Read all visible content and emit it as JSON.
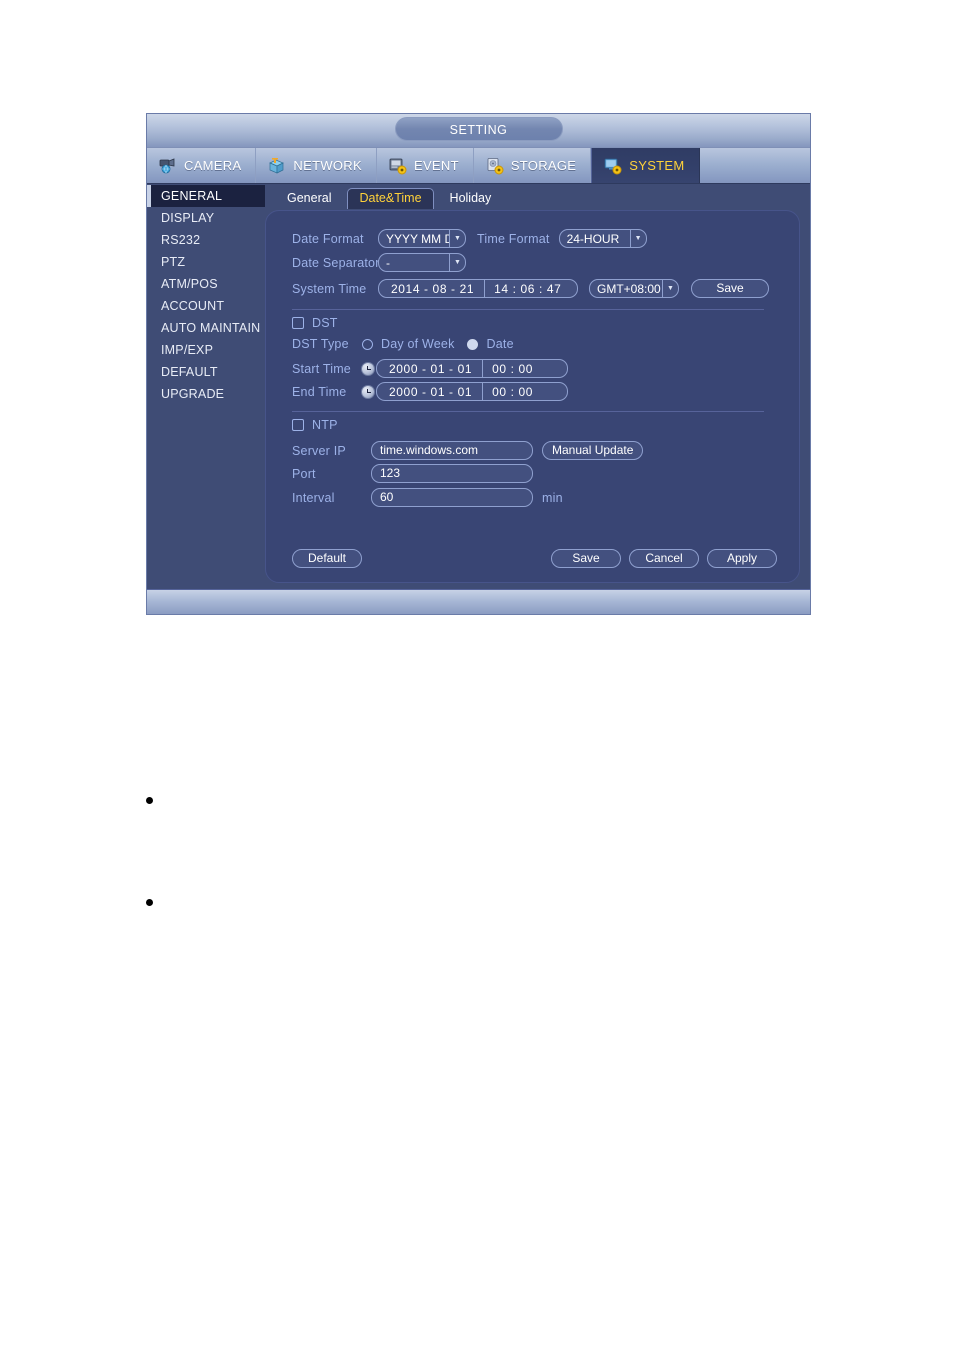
{
  "window": {
    "title": "SETTING"
  },
  "top_tabs": [
    {
      "label": "CAMERA",
      "icon": "camera-icon",
      "active": false
    },
    {
      "label": "NETWORK",
      "icon": "network-icon",
      "active": false
    },
    {
      "label": "EVENT",
      "icon": "event-icon",
      "active": false
    },
    {
      "label": "STORAGE",
      "icon": "storage-icon",
      "active": false
    },
    {
      "label": "SYSTEM",
      "icon": "system-icon",
      "active": true
    }
  ],
  "sidebar": {
    "items": [
      {
        "label": "GENERAL",
        "active": true
      },
      {
        "label": "DISPLAY",
        "active": false
      },
      {
        "label": "RS232",
        "active": false
      },
      {
        "label": "PTZ",
        "active": false
      },
      {
        "label": "ATM/POS",
        "active": false
      },
      {
        "label": "ACCOUNT",
        "active": false
      },
      {
        "label": "AUTO MAINTAIN",
        "active": false
      },
      {
        "label": "IMP/EXP",
        "active": false
      },
      {
        "label": "DEFAULT",
        "active": false
      },
      {
        "label": "UPGRADE",
        "active": false
      }
    ]
  },
  "sub_tabs": [
    {
      "label": "General",
      "active": false
    },
    {
      "label": "Date&Time",
      "active": true
    },
    {
      "label": "Holiday",
      "active": false
    }
  ],
  "form": {
    "date_format": {
      "label": "Date Format",
      "value": "YYYY MM DD"
    },
    "time_format": {
      "label": "Time Format",
      "value": "24-HOUR"
    },
    "date_separator": {
      "label": "Date Separator",
      "value": "-"
    },
    "system_time": {
      "label": "System Time",
      "date": "2014 - 08 - 21",
      "time": "14 :  06 :  47",
      "timezone": "GMT+08:00",
      "save_label": "Save"
    },
    "dst": {
      "label": "DST",
      "checked": false,
      "type_label": "DST Type",
      "option_day_of_week": "Day of Week",
      "option_date": "Date",
      "selected_type": "Date",
      "start_time": {
        "label": "Start Time",
        "date": "2000 - 01 - 01",
        "time": "00 : 00"
      },
      "end_time": {
        "label": "End Time",
        "date": "2000 - 01 - 01",
        "time": "00 : 00"
      }
    },
    "ntp": {
      "label": "NTP",
      "checked": false,
      "server_ip": {
        "label": "Server IP",
        "value": "time.windows.com"
      },
      "manual_update_label": "Manual Update",
      "port": {
        "label": "Port",
        "value": "123"
      },
      "interval": {
        "label": "Interval",
        "value": "60",
        "unit": "min"
      }
    }
  },
  "footer_buttons": {
    "default_label": "Default",
    "save_label": "Save",
    "cancel_label": "Cancel",
    "apply_label": "Apply"
  },
  "colors": {
    "accent_yellow": "#ffd23a",
    "panel_blue": "#394574",
    "window_blue": "#3f4c75",
    "label_blue": "#9db2e8",
    "selected_sidebar": "#1b2240"
  }
}
